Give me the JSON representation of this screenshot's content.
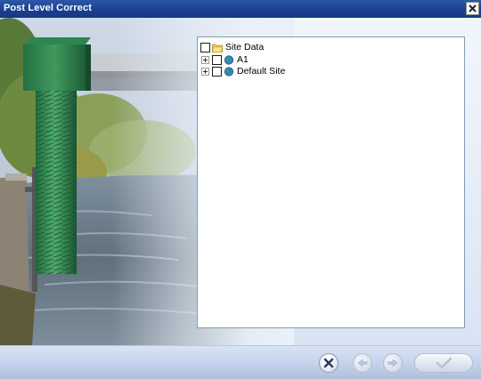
{
  "window": {
    "title": "Post Level Correct",
    "close_icon": "close-x-icon"
  },
  "tree": {
    "root": {
      "label": "Site Data",
      "icon": "folder-icon",
      "checked": false
    },
    "children": [
      {
        "label": "A1",
        "icon": "globe-site-icon",
        "checked": false,
        "expanded": false
      },
      {
        "label": "Default Site",
        "icon": "globe-site-icon",
        "checked": false,
        "expanded": false
      }
    ]
  },
  "toolbar": {
    "cancel_icon": "cancel-x-icon",
    "back_icon": "back-arrow-icon",
    "next_icon": "next-arrow-icon",
    "ok_icon": "checkmark-icon"
  },
  "colors": {
    "titlebar": "#1a3f8e",
    "toolbar": "#c4d4ec",
    "tree_border": "#7f9db9"
  }
}
